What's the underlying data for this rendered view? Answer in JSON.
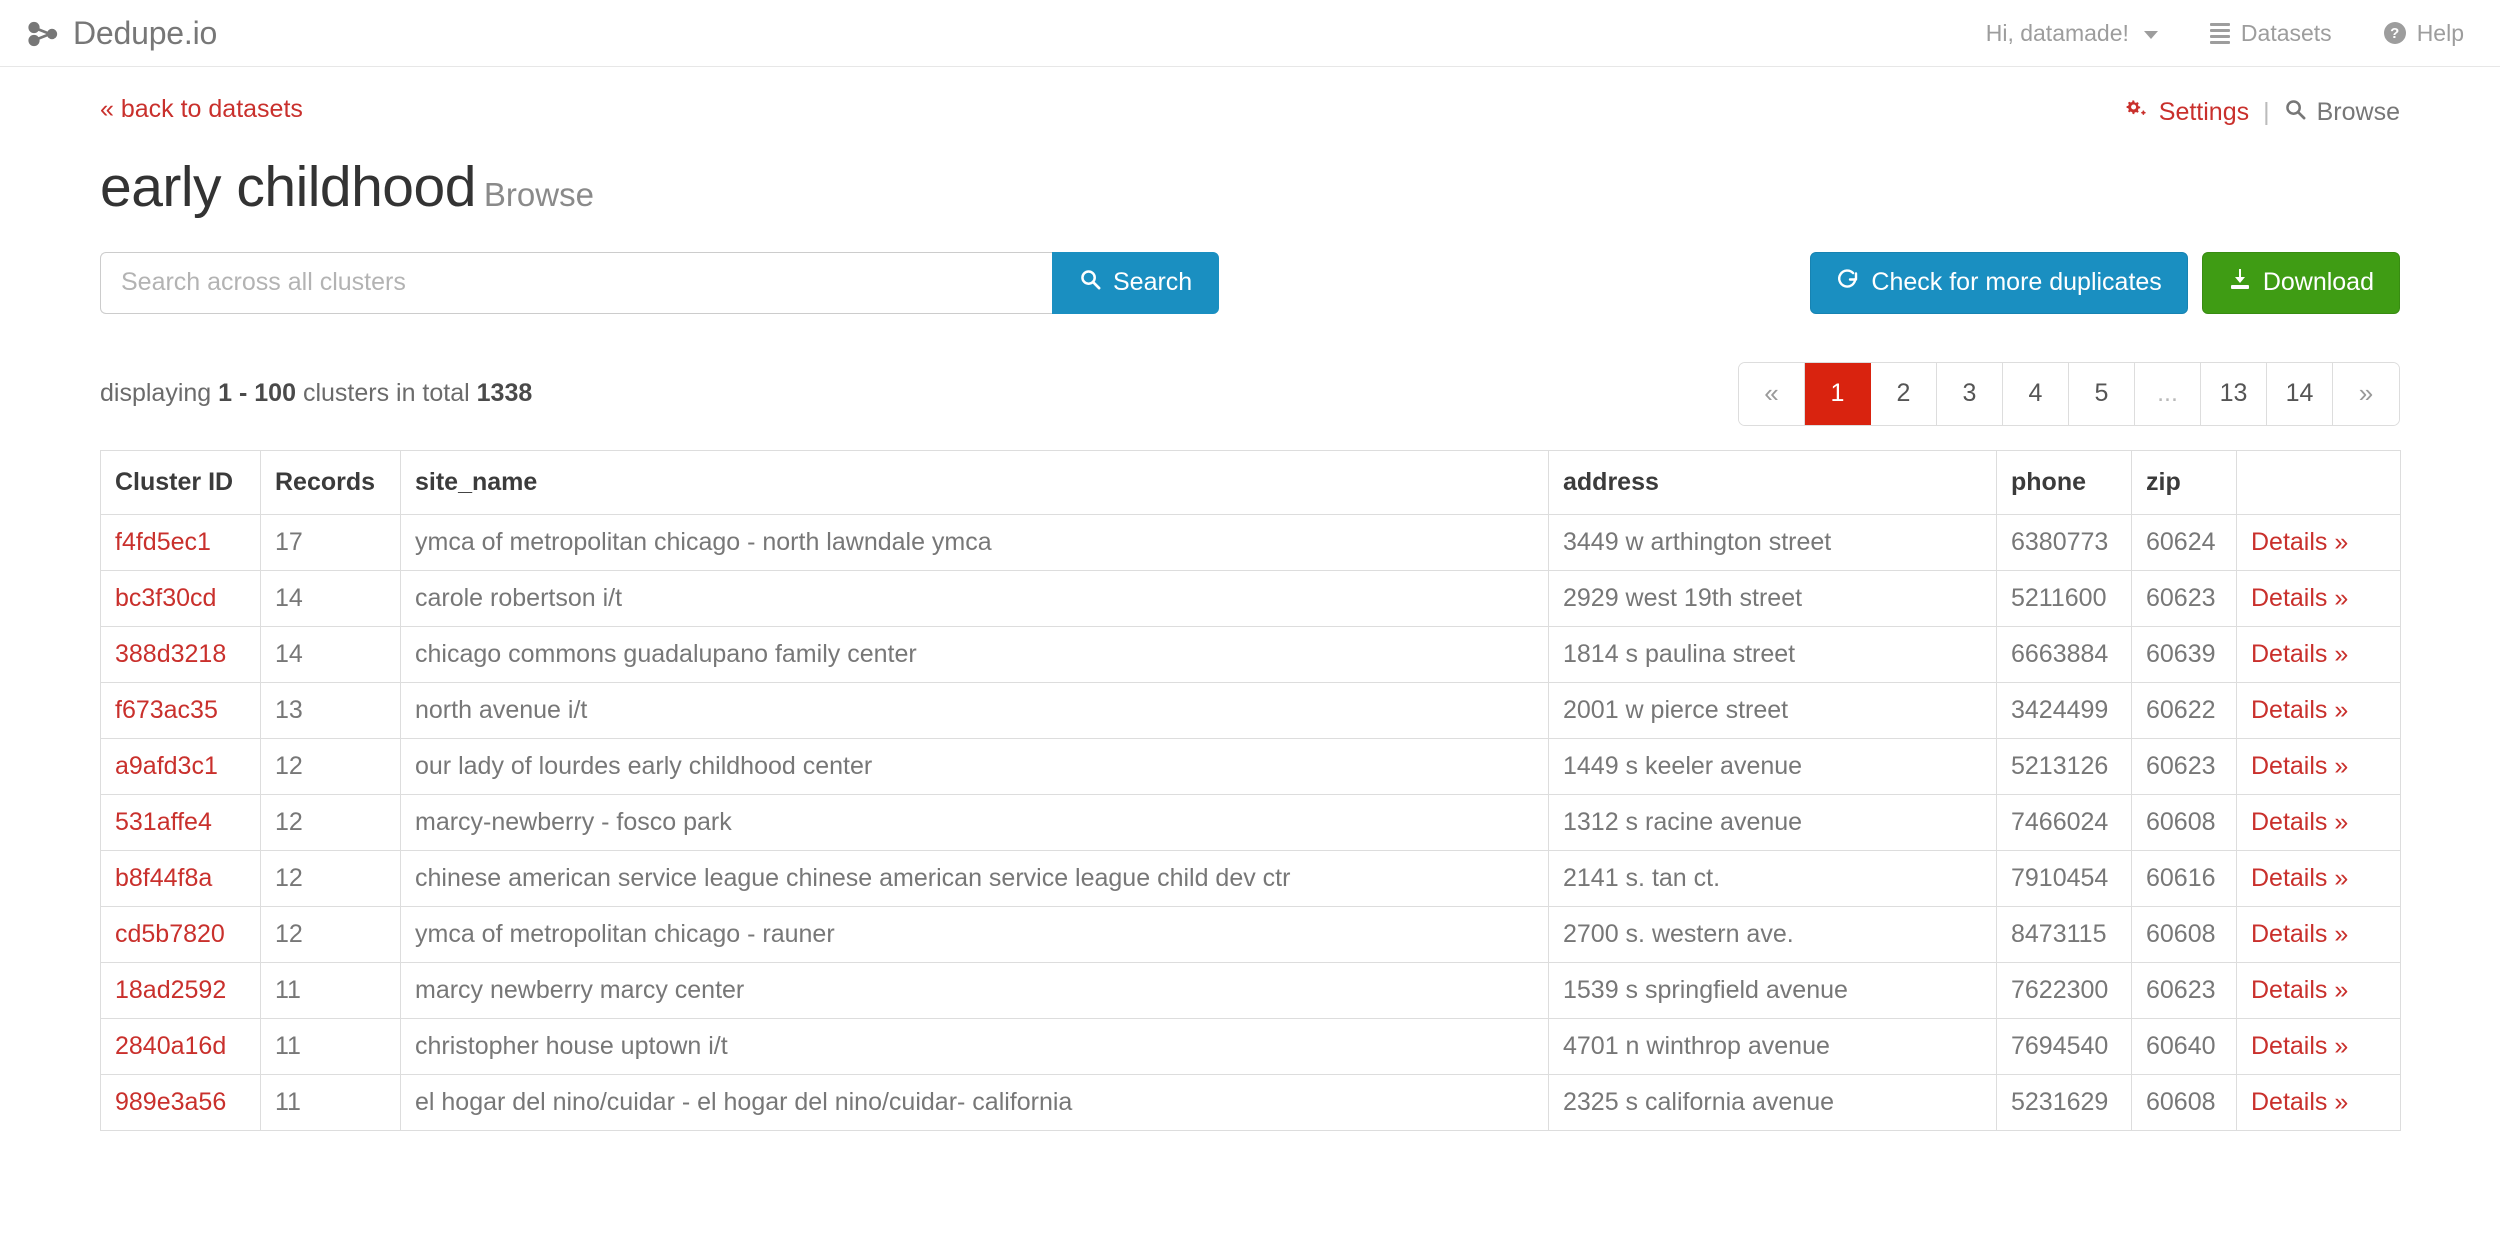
{
  "navbar": {
    "brand": "Dedupe.io",
    "brand_icon": "share-nodes-icon",
    "links": [
      {
        "label": "Hi, datamade!",
        "icon": "caret-down-icon",
        "name": "user-menu"
      },
      {
        "label": "Datasets",
        "icon": "hamburger-icon",
        "name": "datasets"
      },
      {
        "label": "Help",
        "icon": "question-circle-icon",
        "name": "help"
      }
    ]
  },
  "breadcrumb": {
    "back_label": "« back to datasets"
  },
  "page_tools": {
    "settings_label": "Settings",
    "settings_icon": "gears-icon",
    "separator": "|",
    "browse_label": "Browse",
    "browse_icon": "search-icon"
  },
  "header": {
    "title": "early childhood",
    "subtitle": "Browse"
  },
  "search": {
    "placeholder": "Search across all clusters",
    "value": "",
    "button_label": "Search",
    "button_icon": "search-icon"
  },
  "actions": {
    "check_duplicates_label": "Check for more duplicates",
    "check_duplicates_icon": "refresh-icon",
    "download_label": "Download",
    "download_icon": "download-icon"
  },
  "results": {
    "prefix": "displaying",
    "range": "1 - 100",
    "middle": "clusters in total",
    "total": "1338"
  },
  "pagination": {
    "prev": "«",
    "next": "»",
    "ellipsis": "...",
    "pages": [
      "1",
      "2",
      "3",
      "4",
      "5",
      "13",
      "14"
    ],
    "active": "1"
  },
  "table": {
    "columns": [
      "Cluster ID",
      "Records",
      "site_name",
      "address",
      "phone",
      "zip",
      ""
    ],
    "details_label": "Details »",
    "rows": [
      {
        "cluster_id": "f4fd5ec1",
        "records": "17",
        "site_name": "ymca of metropolitan chicago - north lawndale ymca",
        "address": "3449 w arthington street",
        "phone": "6380773",
        "zip": "60624"
      },
      {
        "cluster_id": "bc3f30cd",
        "records": "14",
        "site_name": "carole robertson i/t",
        "address": "2929 west 19th street",
        "phone": "5211600",
        "zip": "60623"
      },
      {
        "cluster_id": "388d3218",
        "records": "14",
        "site_name": "chicago commons guadalupano family center",
        "address": "1814 s paulina street",
        "phone": "6663884",
        "zip": "60639"
      },
      {
        "cluster_id": "f673ac35",
        "records": "13",
        "site_name": "north avenue i/t",
        "address": "2001 w pierce street",
        "phone": "3424499",
        "zip": "60622"
      },
      {
        "cluster_id": "a9afd3c1",
        "records": "12",
        "site_name": "our lady of lourdes early childhood center",
        "address": "1449 s keeler avenue",
        "phone": "5213126",
        "zip": "60623"
      },
      {
        "cluster_id": "531affe4",
        "records": "12",
        "site_name": "marcy-newberry - fosco park",
        "address": "1312 s racine avenue",
        "phone": "7466024",
        "zip": "60608"
      },
      {
        "cluster_id": "b8f44f8a",
        "records": "12",
        "site_name": "chinese american service league chinese american service league child dev ctr",
        "address": "2141 s. tan ct.",
        "phone": "7910454",
        "zip": "60616"
      },
      {
        "cluster_id": "cd5b7820",
        "records": "12",
        "site_name": "ymca of metropolitan chicago - rauner",
        "address": "2700 s. western ave.",
        "phone": "8473115",
        "zip": "60608"
      },
      {
        "cluster_id": "18ad2592",
        "records": "11",
        "site_name": "marcy newberry marcy center",
        "address": "1539 s springfield avenue",
        "phone": "7622300",
        "zip": "60623"
      },
      {
        "cluster_id": "2840a16d",
        "records": "11",
        "site_name": "christopher house uptown i/t",
        "address": "4701 n winthrop avenue",
        "phone": "7694540",
        "zip": "60640"
      },
      {
        "cluster_id": "989e3a56",
        "records": "11",
        "site_name": "el hogar del nino/cuidar - el hogar del nino/cuidar- california",
        "address": "2325 s california avenue",
        "phone": "5231629",
        "zip": "60608"
      }
    ]
  },
  "colors": {
    "brand_red": "#d9230f",
    "link_red": "#c9302c",
    "primary_blue": "#1a8fc1",
    "success_green": "#3f9c14",
    "muted_gray": "#777777"
  }
}
